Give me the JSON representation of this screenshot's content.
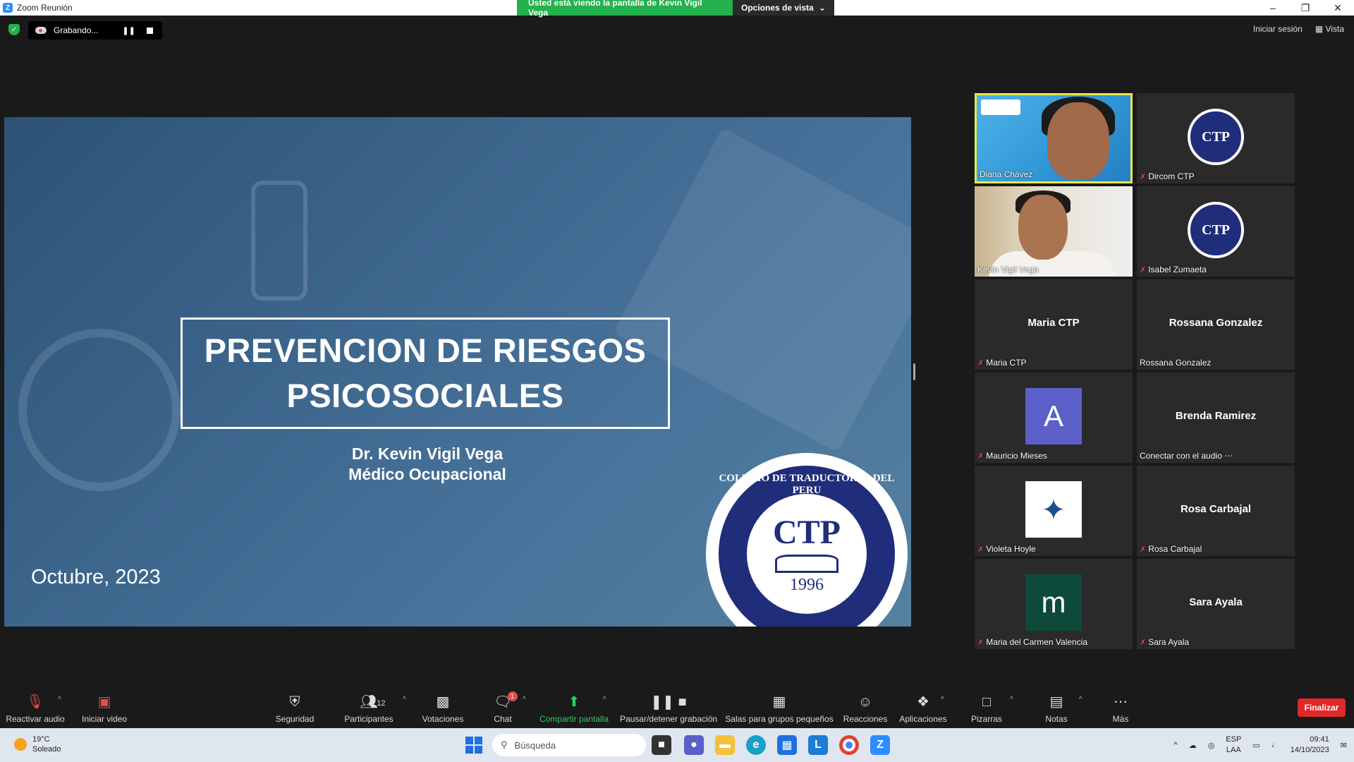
{
  "window": {
    "title": "Zoom Reunión",
    "share_banner": "Usted está viendo la pantalla de Kevin Vigil Vega",
    "view_options": "Opciones de vista"
  },
  "recording": {
    "label": "Grabando..."
  },
  "top_right": {
    "sign_in": "Iniciar sesión",
    "view": "Vista"
  },
  "slide": {
    "title_line1": "PREVENCION DE RIESGOS",
    "title_line2": "PSICOSOCIALES",
    "author": "Dr. Kevin Vigil Vega",
    "role": "Médico Ocupacional",
    "date": "Octubre, 2023",
    "seal_ring_text": "COLEGIO DE TRADUCTORES DEL PERU",
    "seal_center": "CTP",
    "seal_year": "1996"
  },
  "gallery": [
    {
      "name": "Diana Chávez",
      "muted": false,
      "type": "video",
      "active": true
    },
    {
      "name": "Dircom CTP",
      "muted": true,
      "type": "logo"
    },
    {
      "name": "Kevin Vigil Vega",
      "muted": false,
      "type": "video"
    },
    {
      "name": "Isabel Zumaeta",
      "muted": true,
      "type": "logo"
    },
    {
      "name": "Maria CTP",
      "center": "Maria CTP",
      "muted": true,
      "type": "text"
    },
    {
      "name": "Rossana Gonzalez",
      "center": "Rossana Gonzalez",
      "muted": false,
      "type": "text"
    },
    {
      "name": "Mauricio Mieses",
      "muted": true,
      "type": "avatar",
      "letter": "A",
      "color": "#5b5fc7"
    },
    {
      "name": "Conectar con el audio ⋯",
      "center": "Brenda Ramirez",
      "muted": false,
      "type": "text"
    },
    {
      "name": "Violeta Hoyle",
      "muted": true,
      "type": "bird"
    },
    {
      "name": "Rosa Carbajal",
      "center": "Rosa Carbajal",
      "muted": true,
      "type": "text"
    },
    {
      "name": "Maria del Carmen Valencia",
      "muted": true,
      "type": "avatar",
      "letter": "m",
      "color": "#0d4a3a"
    },
    {
      "name": "Sara Ayala",
      "center": "Sara Ayala",
      "muted": true,
      "type": "text"
    }
  ],
  "toolbar": {
    "unmute": "Reactivar audio",
    "start_video": "Iniciar video",
    "security": "Seguridad",
    "participants": "Participantes",
    "participants_count": "12",
    "polls": "Votaciones",
    "chat": "Chat",
    "chat_badge": "1",
    "share": "Compartir pantalla",
    "record": "Pausar/detener grabación",
    "breakout": "Salas para grupos pequeños",
    "reactions": "Reacciones",
    "apps": "Aplicaciones",
    "whiteboards": "Pizarras",
    "notes": "Notas",
    "more": "Más",
    "end": "Finalizar"
  },
  "taskbar": {
    "temperature": "19°C",
    "weather": "Soleado",
    "search": "Búsqueda",
    "lang1": "ESP",
    "lang2": "LAA",
    "time": "09:41",
    "date": "14/10/2023"
  },
  "colors": {
    "share_green": "#23b14d",
    "end_red": "#e02828",
    "active_speaker": "#e8e84a"
  }
}
